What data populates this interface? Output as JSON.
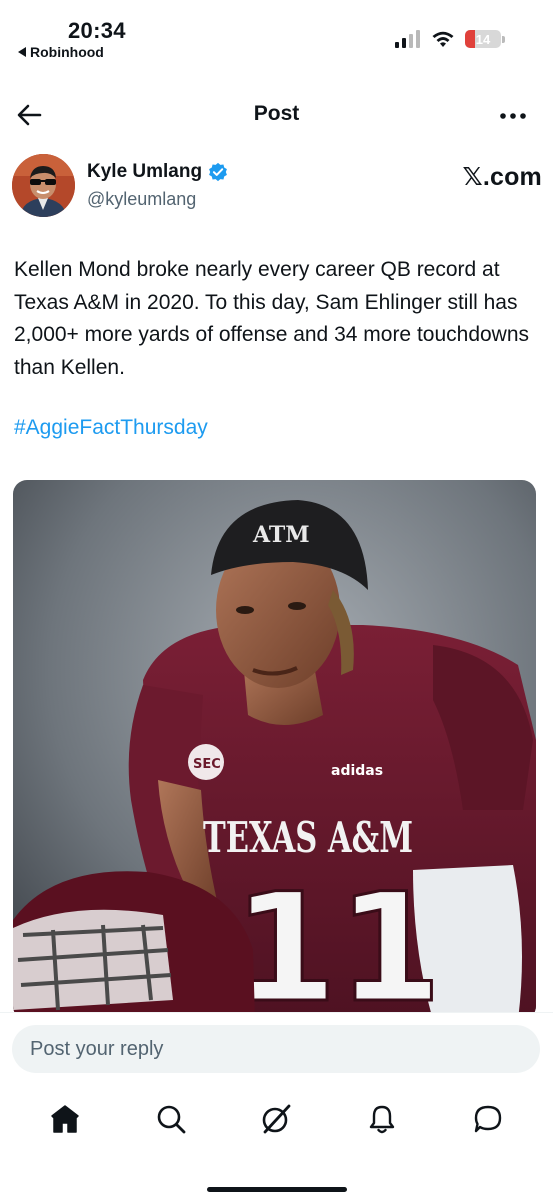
{
  "status_bar": {
    "time": "20:34",
    "back_app": "Robinhood",
    "battery": "14",
    "battery_color": "#e0413b"
  },
  "header": {
    "title": "Post",
    "back_icon": "arrow-left-icon",
    "more_icon": "more-horizontal-icon"
  },
  "author": {
    "name": "Kyle Umlang",
    "handle": "@kyleumlang",
    "verified": true,
    "source": "𝕏.com"
  },
  "tweet": {
    "text": "Kellen Mond broke nearly every career QB record at Texas A&M in 2020. To this day, Sam Ehlinger still has 2,000+ more yards of offense and 34 more touchdowns than Kellen.",
    "hashtag": "#AggieFactThursday"
  },
  "media": {
    "cap_text": "ATM",
    "jersey_text": "TEXAS A&M",
    "sec_logo": "SEC",
    "brand": "adidas",
    "number": "11",
    "accent": "#6b1a2c"
  },
  "reply": {
    "placeholder": "Post your reply"
  },
  "tabs": [
    {
      "name": "home",
      "icon": "home-icon",
      "active": true
    },
    {
      "name": "search",
      "icon": "search-icon",
      "active": false
    },
    {
      "name": "grok",
      "icon": "grok-icon",
      "active": false
    },
    {
      "name": "notifications",
      "icon": "bell-icon",
      "active": false
    },
    {
      "name": "messages",
      "icon": "chat-icon",
      "active": false
    }
  ],
  "colors": {
    "link": "#1d9bf0",
    "text": "#0f1419",
    "secondary": "#536471",
    "input_bg": "#eff3f4"
  }
}
